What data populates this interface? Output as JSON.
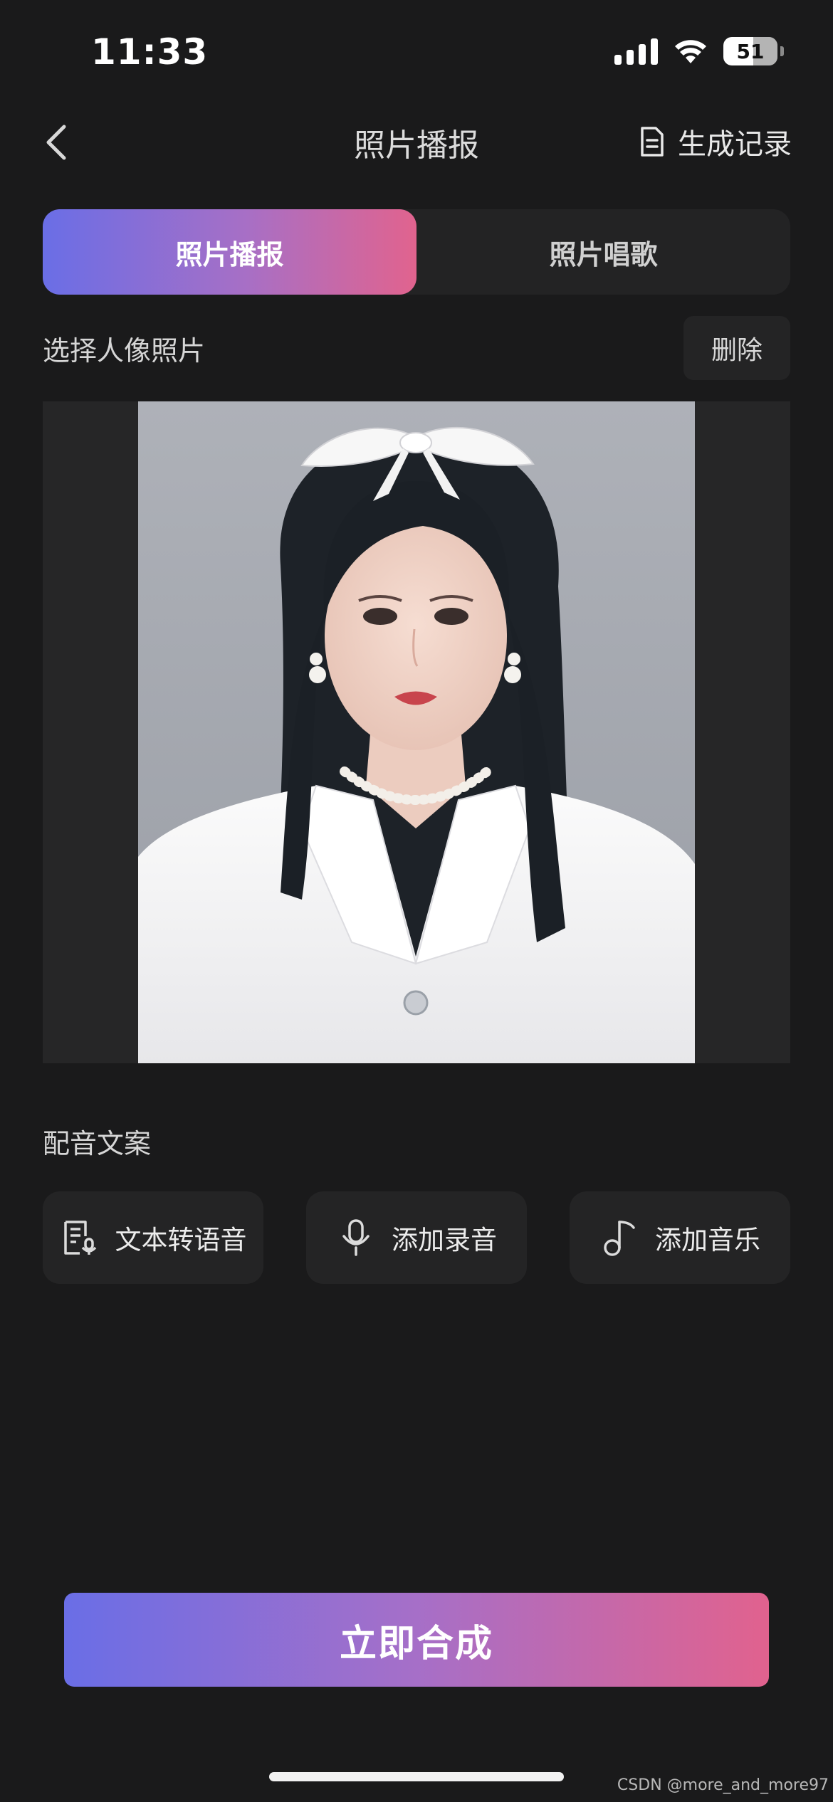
{
  "status_bar": {
    "time": "11:33",
    "battery": "51"
  },
  "nav": {
    "title": "照片播报",
    "history_label": "生成记录"
  },
  "tabs": [
    {
      "label": "照片播报",
      "active": true
    },
    {
      "label": "照片唱歌",
      "active": false
    }
  ],
  "photo_section": {
    "label": "选择人像照片",
    "delete_label": "删除"
  },
  "dubbing": {
    "label": "配音文案",
    "options": [
      {
        "label": "文本转语音",
        "icon": "text-to-speech-icon"
      },
      {
        "label": "添加录音",
        "icon": "microphone-icon"
      },
      {
        "label": "添加音乐",
        "icon": "music-note-icon"
      }
    ]
  },
  "cta": {
    "label": "立即合成"
  },
  "watermark": "CSDN @more_and_more97",
  "colors": {
    "accent_start": "#6a6ee6",
    "accent_end": "#e1638e",
    "background": "#1a1a1b"
  }
}
